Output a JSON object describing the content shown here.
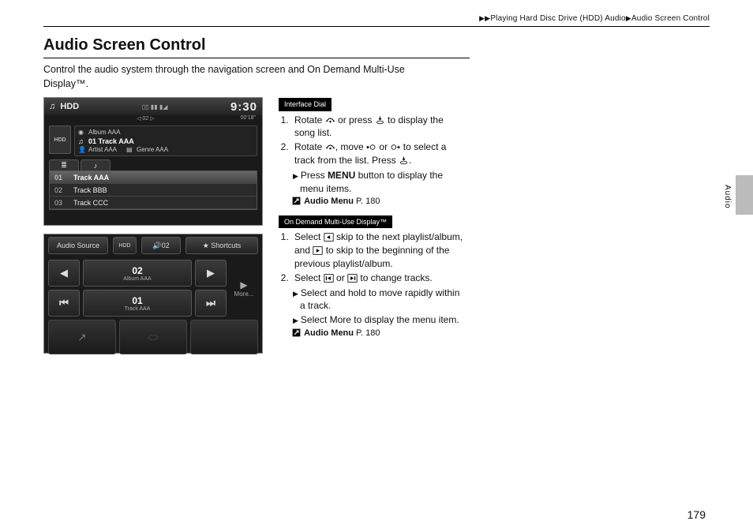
{
  "breadcrumb": {
    "part1": "Playing Hard Disc Drive (HDD) Audio",
    "part2": "Audio Screen Control"
  },
  "title": "Audio Screen Control",
  "intro_line1": "Control the audio system through the navigation screen and On Demand Multi-Use",
  "intro_line2": "Display™.",
  "section1_label": "Interface Dial",
  "section1": {
    "step1_a": "Rotate ",
    "step1_b": " or press ",
    "step1_c": " to display the song list.",
    "step2_a": "Rotate ",
    "step2_b": ", move ",
    "step2_c": " or ",
    "step2_d": " to select a track from the list. Press ",
    "step2_e": ".",
    "sub1_a": "Press ",
    "sub1_menu": "MENU",
    "sub1_b": " button to display the menu items.",
    "ref_label": "Audio Menu",
    "ref_page": " P. 180"
  },
  "section2_label": "On Demand Multi-Use Display™",
  "section2": {
    "step1_a": "Select ",
    "step1_b": " skip to the next playlist/album, and ",
    "step1_c": " to skip to the beginning of the previous playlist/album.",
    "step2_a": "Select ",
    "step2_b": " or ",
    "step2_c": " to change tracks.",
    "sub1": "Select and hold to move rapidly within a track.",
    "sub2_a": "Select ",
    "sub2_more": "More",
    "sub2_b": " to display the menu item.",
    "ref_label": "Audio Menu",
    "ref_page": " P. 180"
  },
  "nav_screen": {
    "source": "HDD",
    "signal": "",
    "clock": "9:30",
    "sub_left": "",
    "sub_mid": "◁ 02 ▷",
    "time": "00'18\"",
    "hdd_icon": "HDD",
    "album_label": "Album AAA",
    "track_label": "01 Track AAA",
    "artist_label": "Artist AAA",
    "genre_label": "Genre AAA",
    "list": [
      {
        "num": "01",
        "name": "Track AAA",
        "selected": true
      },
      {
        "num": "02",
        "name": "Track BBB",
        "selected": false
      },
      {
        "num": "03",
        "name": "Track CCC",
        "selected": false
      }
    ]
  },
  "touch_screen": {
    "audio_source": "Audio Source",
    "hdd": "HDD",
    "volume": "02",
    "shortcuts": "★  Shortcuts",
    "album_num": "02",
    "album_name": "Album AAA",
    "track_num": "01",
    "track_name": "Track AAA",
    "more": "More..."
  },
  "side_tab": "Audio",
  "page_number": "179"
}
